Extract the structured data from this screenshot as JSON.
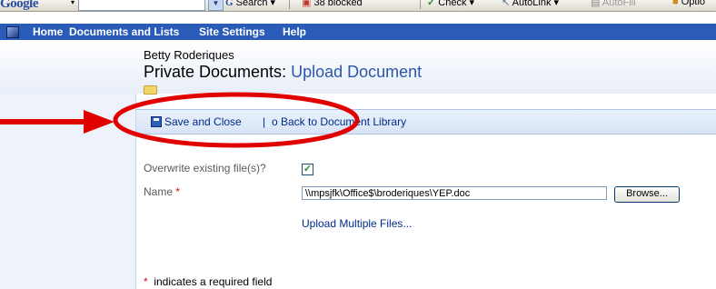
{
  "toolbar": {
    "google_logo": "Google",
    "search_button": "Search",
    "blocked_label": "38 blocked",
    "check_label": "Check",
    "autolink_label": "AutoLink",
    "autofill_label": "AutoFill",
    "options_label": "Optio",
    "icons": [
      "google-g-icon",
      "popup-blocker-icon",
      "spellcheck-icon",
      "autolink-icon",
      "autofill-icon",
      "options-icon"
    ]
  },
  "nav": {
    "items": [
      "Home",
      "Documents and Lists",
      "Site Settings",
      "Help"
    ]
  },
  "header": {
    "site_name": "Betty Roderiques",
    "library_title": "Private Documents",
    "title_separator": ": ",
    "page_subtitle": "Upload Document"
  },
  "actions": {
    "save_close": "Save and Close",
    "separator": "|",
    "back": "o Back to Document Library"
  },
  "form": {
    "overwrite_label": "Overwrite existing file(s)?",
    "overwrite_checked": true,
    "check_mark": "✓",
    "name_label": "Name",
    "required_marker": "*",
    "file_value": "\\\\mpsjfk\\Office$\\broderiques\\YEP.doc",
    "browse_button": "Browse...",
    "upload_multiple": "Upload Multiple Files...",
    "required_note": "indicates a required field"
  },
  "colors": {
    "nav_bar": "#2a5bb9",
    "link": "#002a8a",
    "subtitle": "#2a57a8",
    "required": "#cc1111",
    "annotation_red": "#e00000"
  }
}
